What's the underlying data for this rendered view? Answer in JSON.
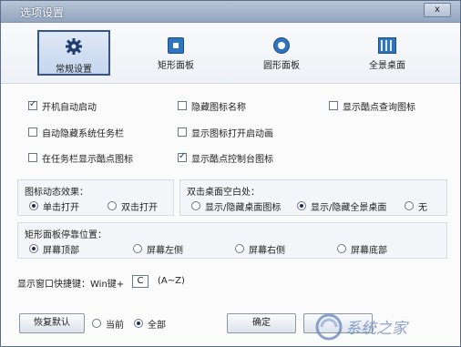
{
  "window": {
    "title": "选项设置",
    "close_label": "x"
  },
  "tabs": [
    {
      "label": "常规设置",
      "icon": "gear-icon"
    },
    {
      "label": "矩形面板",
      "icon": "square-panel-icon"
    },
    {
      "label": "圆形面板",
      "icon": "circle-panel-icon"
    },
    {
      "label": "全景桌面",
      "icon": "grid-desktop-icon"
    }
  ],
  "options": {
    "boot_start": {
      "label": "开机自动启动",
      "checked": true
    },
    "hide_icon_name": {
      "label": "隐藏图标名称",
      "checked": false
    },
    "show_cool_query": {
      "label": "显示酷点查询图标",
      "checked": false
    },
    "auto_hide_taskbar": {
      "label": "自动隐藏系统任务栏",
      "checked": false
    },
    "show_icon_anim": {
      "label": "显示图标打开启动画",
      "checked": false
    },
    "taskbar_cool_icon": {
      "label": "在任务栏显示酷点图标",
      "checked": false
    },
    "show_console_icon": {
      "label": "显示酷点控制台图标",
      "checked": true
    }
  },
  "icon_effect": {
    "title": "图标动态效果：",
    "single_click": "单击打开",
    "double_click": "双击打开",
    "selected": "单击打开"
  },
  "desktop_dblclick": {
    "title": "双击桌面空白处：",
    "opt1": "显示/隐藏桌面图标",
    "opt2": "显示/隐藏全景桌面",
    "opt3": "无",
    "selected": "显示/隐藏全景桌面"
  },
  "panel_dock": {
    "title": "矩形面板停靠位置：",
    "top": "屏幕顶部",
    "left": "屏幕左侧",
    "right": "屏幕右侧",
    "bottom": "屏幕底部",
    "selected": "屏幕顶部"
  },
  "hotkey": {
    "label": "显示窗口快捷键：Win键+",
    "value": "C",
    "range": "(A~Z)"
  },
  "footer": {
    "restore_label": "恢复默认",
    "scope_current": "当前",
    "scope_all": "全部",
    "scope_selected": "全部",
    "ok_label": "确定"
  },
  "watermark": {
    "text": "系统之家"
  },
  "colors": {
    "accent": "#35548d",
    "titlebar": "#a8b8cf",
    "icon_blue": "#2f74bd"
  }
}
